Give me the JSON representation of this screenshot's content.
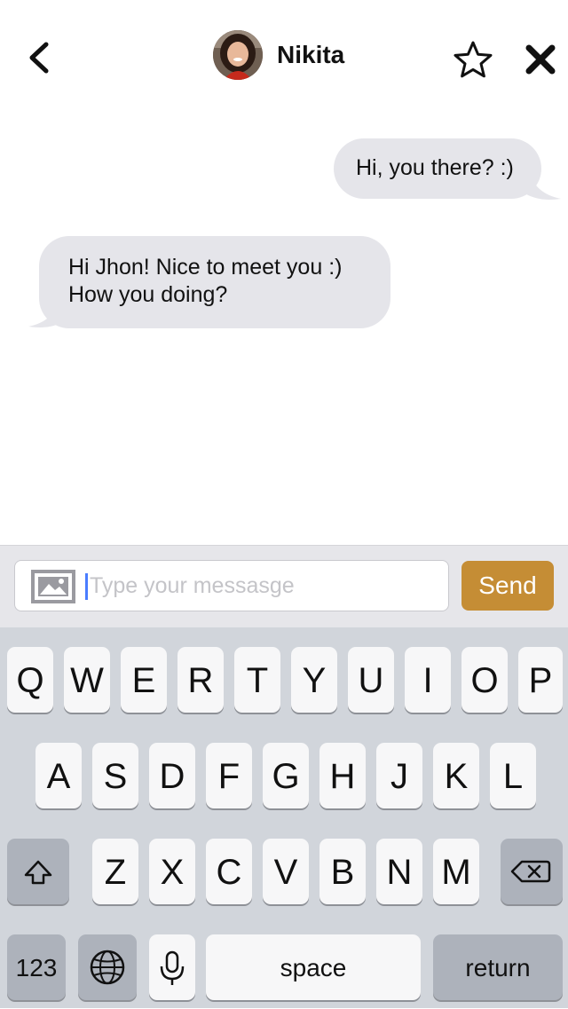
{
  "header": {
    "contact_name": "Nikita"
  },
  "messages": [
    {
      "direction": "outgoing",
      "text": "Hi, you there? :)"
    },
    {
      "direction": "incoming",
      "text": "Hi Jhon! Nice to meet you :)\nHow you doing?"
    }
  ],
  "composer": {
    "placeholder": "Type your messasge",
    "value": "",
    "send_label": "Send"
  },
  "keyboard": {
    "row1": [
      "Q",
      "W",
      "E",
      "R",
      "T",
      "Y",
      "U",
      "I",
      "O",
      "P"
    ],
    "row2": [
      "A",
      "S",
      "D",
      "F",
      "G",
      "H",
      "J",
      "K",
      "L"
    ],
    "row3": [
      "Z",
      "X",
      "C",
      "V",
      "B",
      "N",
      "M"
    ],
    "numbers_label": "123",
    "space_label": "space",
    "return_label": "return"
  },
  "colors": {
    "accent": "#c58d35",
    "bubble": "#e5e5ea",
    "keyboard_bg": "#d1d5db",
    "caret": "#4a7dff"
  },
  "icons": [
    "back-chevron-icon",
    "avatar",
    "star-icon",
    "close-icon",
    "image-icon",
    "shift-icon",
    "backspace-icon",
    "globe-icon",
    "microphone-icon"
  ]
}
